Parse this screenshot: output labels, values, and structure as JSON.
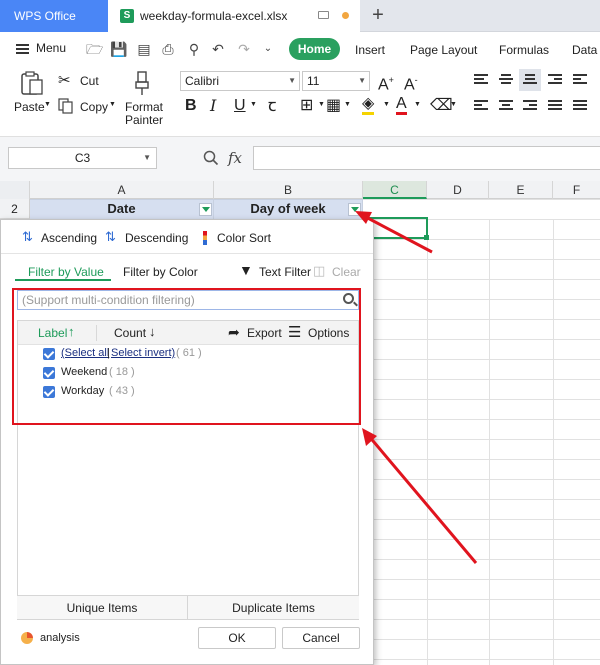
{
  "titlebar": {
    "app_tab": "WPS Office",
    "doc_tab": "weekday-formula-excel.xlsx",
    "new_tab": "+"
  },
  "menubar": {
    "menu_label": "Menu",
    "tabs": [
      "Home",
      "Insert",
      "Page Layout",
      "Formulas",
      "Data"
    ]
  },
  "ribbon": {
    "paste": "Paste",
    "cut": "Cut",
    "copy": "Copy",
    "format_painter_1": "Format",
    "format_painter_2": "Painter",
    "font_name": "Calibri",
    "font_size": "11"
  },
  "formula_bar": {
    "name_box": "C3",
    "fx": "fx",
    "formula": ""
  },
  "sheet": {
    "columns": [
      "A",
      "B",
      "C",
      "D",
      "E",
      "F"
    ],
    "row_number": "2",
    "header_a": "Date",
    "header_b": "Day of week"
  },
  "filter_panel": {
    "ascending": "Ascending",
    "descending": "Descending",
    "color_sort": "Color Sort",
    "tab_value": "Filter by Value",
    "tab_color": "Filter by Color",
    "text_filter": "Text Filter",
    "clear": "Clear",
    "search_placeholder": "(Support multi-condition filtering)",
    "col_label": "Label",
    "col_count": "Count",
    "export": "Export",
    "options": "Options",
    "items": [
      {
        "label_a": "(Select all",
        "label_b": "Select invert)",
        "count": "( 61 )",
        "checked": true
      },
      {
        "label": "Weekend",
        "count": "( 18 )",
        "checked": true
      },
      {
        "label": "Workday",
        "count": "( 43 )",
        "checked": true
      }
    ],
    "unique_items": "Unique Items",
    "duplicate_items": "Duplicate Items",
    "analysis": "analysis",
    "ok": "OK",
    "cancel": "Cancel"
  },
  "colors": {
    "accent_green": "#1e9b5a",
    "app_blue": "#4a86f6",
    "annotation_red": "#e0141e"
  }
}
